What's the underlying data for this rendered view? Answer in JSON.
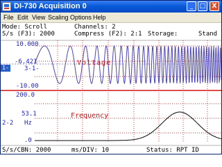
{
  "window": {
    "title": "DI-730 Acquisition 0",
    "minimize_glyph": "_",
    "maximize_glyph": "□",
    "close_glyph": "X"
  },
  "menu": [
    "File",
    "Edit",
    "View",
    "Scaling",
    "Options",
    "Help"
  ],
  "info": {
    "mode": "Mode: Scroll",
    "channels": "Channels: 2",
    "sample_rate": "S/s (F3): 2000",
    "compress": "Compress (F2): 2:1",
    "storage": "Storage:",
    "storage_value": "Stand"
  },
  "channel1": {
    "name": "Voltage",
    "top_value": "10.000",
    "cursor_value": "-6.421",
    "cursor_sub": "3-1-",
    "selected": "1-1",
    "bottom_value": "-10.00"
  },
  "channel2": {
    "name": "Frequency",
    "top_value": "200.0",
    "value": "53.1",
    "sub": "2-2",
    "unit": "Hz",
    "bottom_value": ".0"
  },
  "status": {
    "left": "S/s/CBN: 2000",
    "middle": "ms/DIV: 10",
    "right": "Status: RPT ID"
  },
  "colors": {
    "title_bar": "#0a5ad8",
    "voltage_wave": "#4a44b8",
    "frequency_trace": "#0a0a0a",
    "grid": "#d93030",
    "text_blue": "#2020c8",
    "text_red": "#d01010"
  }
}
